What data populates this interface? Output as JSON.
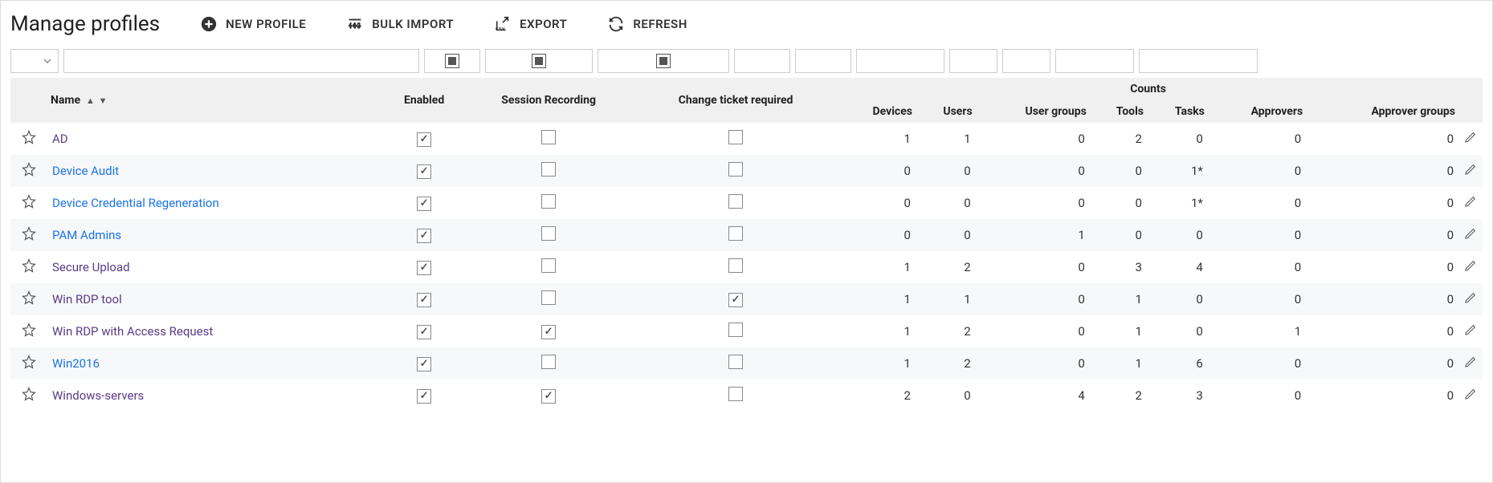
{
  "header": {
    "title": "Manage profiles",
    "actions": {
      "new_profile": "NEW PROFILE",
      "bulk_import": "BULK IMPORT",
      "export": "EXPORT",
      "refresh": "REFRESH"
    }
  },
  "columns": {
    "name": "Name",
    "enabled": "Enabled",
    "session_recording": "Session Recording",
    "change_ticket": "Change ticket required",
    "counts": "Counts",
    "devices": "Devices",
    "users": "Users",
    "user_groups": "User groups",
    "tools": "Tools",
    "tasks": "Tasks",
    "approvers": "Approvers",
    "approver_groups": "Approver groups"
  },
  "rows": [
    {
      "name": "AD",
      "link": false,
      "enabled": true,
      "session": false,
      "change": false,
      "devices": "1",
      "users": "1",
      "user_groups": "0",
      "tools": "2",
      "tasks": "0",
      "approvers": "0",
      "approver_groups": "0"
    },
    {
      "name": "Device Audit",
      "link": true,
      "enabled": true,
      "session": false,
      "change": false,
      "devices": "0",
      "users": "0",
      "user_groups": "0",
      "tools": "0",
      "tasks": "1*",
      "approvers": "0",
      "approver_groups": "0"
    },
    {
      "name": "Device Credential Regeneration",
      "link": true,
      "enabled": true,
      "session": false,
      "change": false,
      "devices": "0",
      "users": "0",
      "user_groups": "0",
      "tools": "0",
      "tasks": "1*",
      "approvers": "0",
      "approver_groups": "0"
    },
    {
      "name": "PAM Admins",
      "link": true,
      "enabled": true,
      "session": false,
      "change": false,
      "devices": "0",
      "users": "0",
      "user_groups": "1",
      "tools": "0",
      "tasks": "0",
      "approvers": "0",
      "approver_groups": "0"
    },
    {
      "name": "Secure Upload",
      "link": false,
      "enabled": true,
      "session": false,
      "change": false,
      "devices": "1",
      "users": "2",
      "user_groups": "0",
      "tools": "3",
      "tasks": "4",
      "approvers": "0",
      "approver_groups": "0"
    },
    {
      "name": "Win RDP tool",
      "link": false,
      "enabled": true,
      "session": false,
      "change": true,
      "devices": "1",
      "users": "1",
      "user_groups": "0",
      "tools": "1",
      "tasks": "0",
      "approvers": "0",
      "approver_groups": "0"
    },
    {
      "name": "Win RDP with Access Request",
      "link": false,
      "enabled": true,
      "session": true,
      "change": false,
      "devices": "1",
      "users": "2",
      "user_groups": "0",
      "tools": "1",
      "tasks": "0",
      "approvers": "1",
      "approver_groups": "0"
    },
    {
      "name": "Win2016",
      "link": true,
      "enabled": true,
      "session": false,
      "change": false,
      "devices": "1",
      "users": "2",
      "user_groups": "0",
      "tools": "1",
      "tasks": "6",
      "approvers": "0",
      "approver_groups": "0"
    },
    {
      "name": "Windows-servers",
      "link": false,
      "enabled": true,
      "session": true,
      "change": false,
      "devices": "2",
      "users": "0",
      "user_groups": "4",
      "tools": "2",
      "tasks": "3",
      "approvers": "0",
      "approver_groups": "0"
    }
  ]
}
